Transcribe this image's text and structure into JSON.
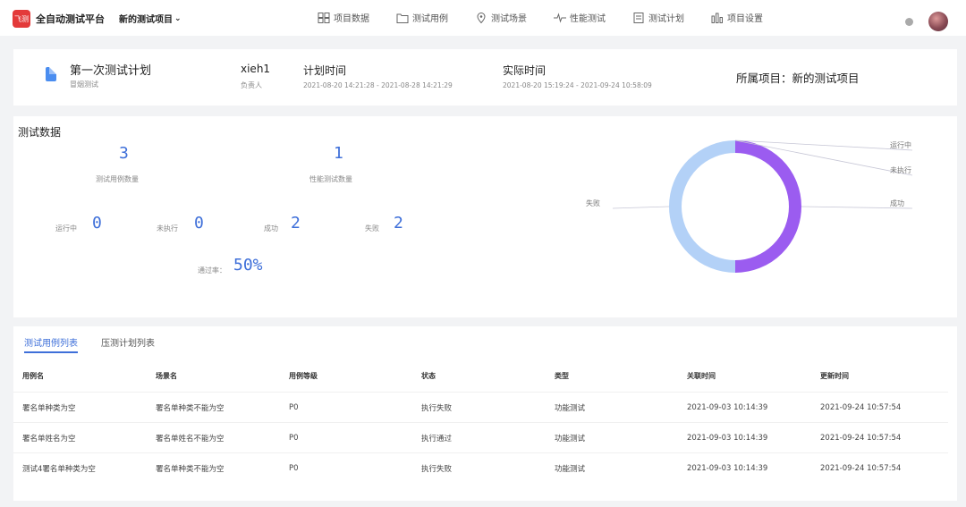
{
  "topnav": {
    "logo_text": "飞测",
    "app_title": "全自动测试平台",
    "project_select": "新的测试项目",
    "items": [
      {
        "label": "项目数据",
        "icon": "grid-icon"
      },
      {
        "label": "测试用例",
        "icon": "folder-icon"
      },
      {
        "label": "测试场景",
        "icon": "location-icon"
      },
      {
        "label": "性能测试",
        "icon": "pulse-icon"
      },
      {
        "label": "测试计划",
        "icon": "checklist-icon"
      },
      {
        "label": "项目设置",
        "icon": "bar-settings-icon"
      }
    ]
  },
  "plan": {
    "name": "第一次测试计划",
    "type": "冒烟测试",
    "owner": "xieh1",
    "owner_label": "负责人",
    "plan_time_label": "计划时间",
    "plan_time_value": "2021-08-20 14:21:28 - 2021-08-28 14:21:29",
    "actual_time_label": "实际时间",
    "actual_time_value": "2021-08-20 15:19:24 - 2021-09-24 10:58:09",
    "project_label": "所属项目：新的测试项目"
  },
  "stats": {
    "title": "测试数据",
    "case_count": "3",
    "case_count_label": "测试用例数量",
    "perf_count": "1",
    "perf_count_label": "性能测试数量",
    "running_label": "运行中",
    "running": "0",
    "not_run_label": "未执行",
    "not_run": "0",
    "success_label": "成功",
    "success": "2",
    "fail_label": "失败",
    "fail": "2",
    "pass_rate_label": "通过率：",
    "pass_rate": "50%"
  },
  "chart_data": {
    "type": "pie",
    "categories": [
      "运行中",
      "未执行",
      "成功",
      "失败"
    ],
    "values": [
      0,
      0,
      2,
      2
    ],
    "colors": [
      "#a78bfa",
      "#a78bfa",
      "#9b5cf0",
      "#b3d1f7"
    ]
  },
  "table": {
    "tabs": [
      "测试用例列表",
      "压测计划列表"
    ],
    "columns": [
      "用例名",
      "场景名",
      "用例等级",
      "状态",
      "类型",
      "关联时间",
      "更新时间"
    ],
    "rows": [
      [
        "署名单种类为空",
        "署名单种类不能为空",
        "P0",
        "执行失败",
        "功能测试",
        "2021-09-03 10:14:39",
        "2021-09-24 10:57:54"
      ],
      [
        "署名单姓名为空",
        "署名单姓名不能为空",
        "P0",
        "执行通过",
        "功能测试",
        "2021-09-03 10:14:39",
        "2021-09-24 10:57:54"
      ],
      [
        "测试4署名单种类为空",
        "署名单种类不能为空",
        "P0",
        "执行失败",
        "功能测试",
        "2021-09-03 10:14:39",
        "2021-09-24 10:57:54"
      ]
    ]
  }
}
